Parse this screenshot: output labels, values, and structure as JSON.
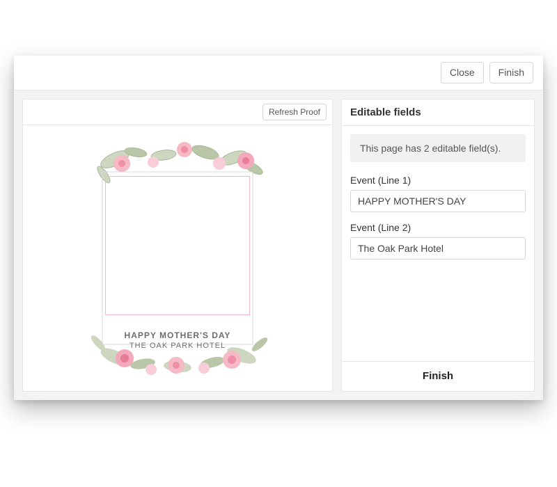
{
  "header": {
    "close_label": "Close",
    "finish_label": "Finish"
  },
  "proof": {
    "refresh_label": "Refresh Proof",
    "caption_line1": "HAPPY MOTHER'S DAY",
    "caption_line2": "THE OAK PARK HOTEL"
  },
  "sidebar": {
    "title": "Editable fields",
    "notice": "This page has 2 editable field(s).",
    "fields": [
      {
        "label": "Event (Line 1)",
        "value": "HAPPY MOTHER'S DAY"
      },
      {
        "label": "Event (Line 2)",
        "value": "The Oak Park Hotel"
      }
    ],
    "finish_label": "Finish"
  }
}
